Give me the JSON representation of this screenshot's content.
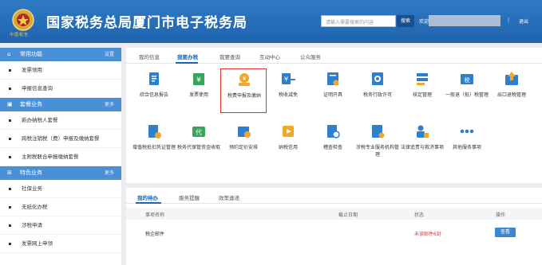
{
  "header": {
    "emblem_text": "中国税务",
    "title": "国家税务总局厦门市电子税务局",
    "search_placeholder": "请输入需要搜索的内容",
    "search_button": "搜索",
    "welcome": "欢迎",
    "separator": "|",
    "logout": "退出"
  },
  "sidebar": {
    "sections": [
      {
        "title": "常用功能",
        "more": "设置",
        "icon": "home-icon",
        "items": [
          "发票领用",
          "申报信息查询"
        ]
      },
      {
        "title": "套餐业务",
        "more": "更多",
        "icon": "package-icon",
        "items": [
          "新办纳税人套餐",
          "跨税注销税（费）申报及缴纳套餐",
          "主附税联合申报缴纳套餐"
        ]
      },
      {
        "title": "特色业务",
        "more": "更多",
        "icon": "grid-icon",
        "items": [
          "社保业务",
          "无纸化办税",
          "涉税申请",
          "发票网上申领"
        ]
      }
    ]
  },
  "main": {
    "tabs": [
      "我的信息",
      "我要办税",
      "我要查询",
      "互动中心",
      "公众服务"
    ],
    "active_tab": "我要办税",
    "tiles_row1": [
      {
        "label": "综合信息报告",
        "icon": "report-icon",
        "color": "#2f7fd1"
      },
      {
        "label": "发票使用",
        "icon": "invoice-icon",
        "color": "#3aa45c"
      },
      {
        "label": "税费申报及缴纳",
        "icon": "declare-pay-icon",
        "color": "#f0a82c"
      },
      {
        "label": "税收减免",
        "icon": "tax-reduction-icon",
        "color": "#2f7fd1"
      },
      {
        "label": "证明开具",
        "icon": "certificate-icon",
        "color": "#2f7fd1"
      },
      {
        "label": "税务行政许可",
        "icon": "admin-license-icon",
        "color": "#2f7fd1"
      },
      {
        "label": "核定管理",
        "icon": "approval-icon",
        "color": "#2f7fd1"
      },
      {
        "label": "一般退（抵）税管理",
        "icon": "refund-icon",
        "color": "#2f7fd1"
      },
      {
        "label": "出口退税管理",
        "icon": "export-refund-icon",
        "color": "#2f7fd1"
      }
    ],
    "tiles_row2": [
      {
        "label": "增值税抵扣凭证管理",
        "icon": "vat-deduction-icon",
        "color": "#2f7fd1"
      },
      {
        "label": "税务代保管资金收取",
        "icon": "custody-fund-icon",
        "color": "#3aa45c"
      },
      {
        "label": "预约定价安排",
        "icon": "pricing-schedule-icon",
        "color": "#2f7fd1"
      },
      {
        "label": "纳税信用",
        "icon": "credit-icon",
        "color": "#f0a82c"
      },
      {
        "label": "稽查检查",
        "icon": "inspection-icon",
        "color": "#2f7fd1"
      },
      {
        "label": "涉税专业服务机构管理",
        "icon": "agency-icon",
        "color": "#2f7fd1"
      },
      {
        "label": "法律追责与救济事项",
        "icon": "legal-icon",
        "color": "#2f7fd1"
      },
      {
        "label": "其他服务事项",
        "icon": "more-dots-icon",
        "color": "#2f7fd1"
      }
    ]
  },
  "todo": {
    "tabs": [
      "我的待办",
      "服务提醒",
      "政策速递"
    ],
    "active_tab": "我的待办",
    "columns": [
      "事项名称",
      "截止日期",
      "状态",
      "操作"
    ],
    "rows": [
      {
        "name": "税企邮件",
        "deadline": "",
        "status": "未读邮件6封",
        "action": "查看"
      }
    ],
    "status_color": "#e0312b"
  }
}
